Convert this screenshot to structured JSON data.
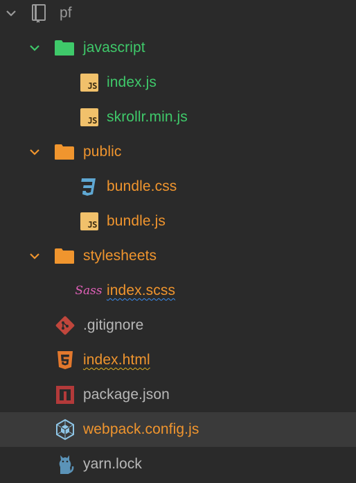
{
  "colors": {
    "background": "#2a2a2a",
    "selected_row": "#3a3a3a",
    "untracked_green": "#3fc96a",
    "modified_orange": "#f0952e",
    "normal_text": "#b8b8b8",
    "root_gray": "#9a9a9a"
  },
  "tree": {
    "root": {
      "label": "pf",
      "icon": "repo-icon",
      "expanded": true
    },
    "items": [
      {
        "label": "javascript",
        "type": "folder",
        "icon": "folder-icon",
        "expanded": true,
        "status": "untracked"
      },
      {
        "label": "index.js",
        "type": "file",
        "icon": "js-file-icon",
        "status": "untracked"
      },
      {
        "label": "skrollr.min.js",
        "type": "file",
        "icon": "js-file-icon",
        "status": "untracked"
      },
      {
        "label": "public",
        "type": "folder",
        "icon": "folder-icon",
        "expanded": true,
        "status": "modified"
      },
      {
        "label": "bundle.css",
        "type": "file",
        "icon": "css3-file-icon",
        "status": "modified"
      },
      {
        "label": "bundle.js",
        "type": "file",
        "icon": "js-file-icon",
        "status": "modified"
      },
      {
        "label": "stylesheets",
        "type": "folder",
        "icon": "folder-icon",
        "expanded": true,
        "status": "modified"
      },
      {
        "label": "index.scss",
        "type": "file",
        "icon": "sass-file-icon",
        "status": "modified",
        "spellcheck": "blue"
      },
      {
        "label": ".gitignore",
        "type": "file",
        "icon": "git-file-icon",
        "status": "normal"
      },
      {
        "label": "index.html",
        "type": "file",
        "icon": "html5-file-icon",
        "status": "modified",
        "spellcheck": "orange"
      },
      {
        "label": "package.json",
        "type": "file",
        "icon": "npm-file-icon",
        "status": "normal"
      },
      {
        "label": "webpack.config.js",
        "type": "file",
        "icon": "webpack-file-icon",
        "status": "modified",
        "selected": true
      },
      {
        "label": "yarn.lock",
        "type": "file",
        "icon": "yarn-file-icon",
        "status": "normal"
      }
    ]
  },
  "badges": {
    "js": "JS",
    "sass": "Sass"
  }
}
